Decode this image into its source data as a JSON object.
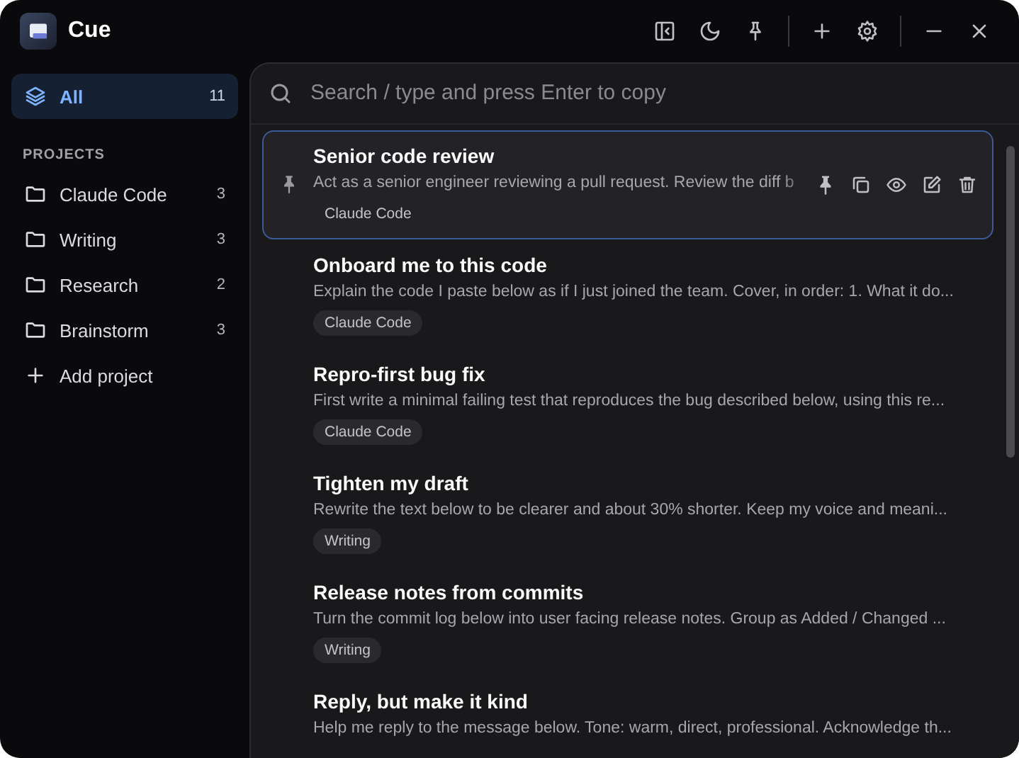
{
  "window": {
    "title": "Cue"
  },
  "sidebar": {
    "all": {
      "label": "All",
      "count": "11",
      "selected": true
    },
    "section_title": "PROJECTS",
    "projects": [
      {
        "name": "Claude Code",
        "count": "3",
        "selected": false
      },
      {
        "name": "Writing",
        "count": "3",
        "selected": false
      },
      {
        "name": "Research",
        "count": "2",
        "selected": false
      },
      {
        "name": "Brainstorm",
        "count": "3",
        "selected": false
      }
    ],
    "add_label": "Add project"
  },
  "search": {
    "placeholder": "Search / type and press Enter to copy"
  },
  "prompts": [
    {
      "title": "Senior code review",
      "body": "Act as a senior engineer reviewing a pull request. Review the diff b",
      "tag": "Claude Code",
      "pinned": true,
      "selected": true
    },
    {
      "title": "Onboard me to this code",
      "body": "Explain the code I paste below as if I just joined the team. Cover, in order: 1. What it do...",
      "tag": "Claude Code",
      "pinned": false,
      "selected": false
    },
    {
      "title": "Repro-first bug fix",
      "body": "First write a minimal failing test that reproduces the bug described below, using this re...",
      "tag": "Claude Code",
      "pinned": false,
      "selected": false
    },
    {
      "title": "Tighten my draft",
      "body": "Rewrite the text below to be clearer and about 30% shorter. Keep my voice and meani...",
      "tag": "Writing",
      "pinned": false,
      "selected": false
    },
    {
      "title": "Release notes from commits",
      "body": "Turn the commit log below into user facing release notes. Group as Added / Changed ...",
      "tag": "Writing",
      "pinned": false,
      "selected": false
    },
    {
      "title": "Reply, but make it kind",
      "body": "Help me reply to the message below. Tone: warm, direct, professional. Acknowledge th...",
      "pinned": false,
      "selected": false
    }
  ]
}
